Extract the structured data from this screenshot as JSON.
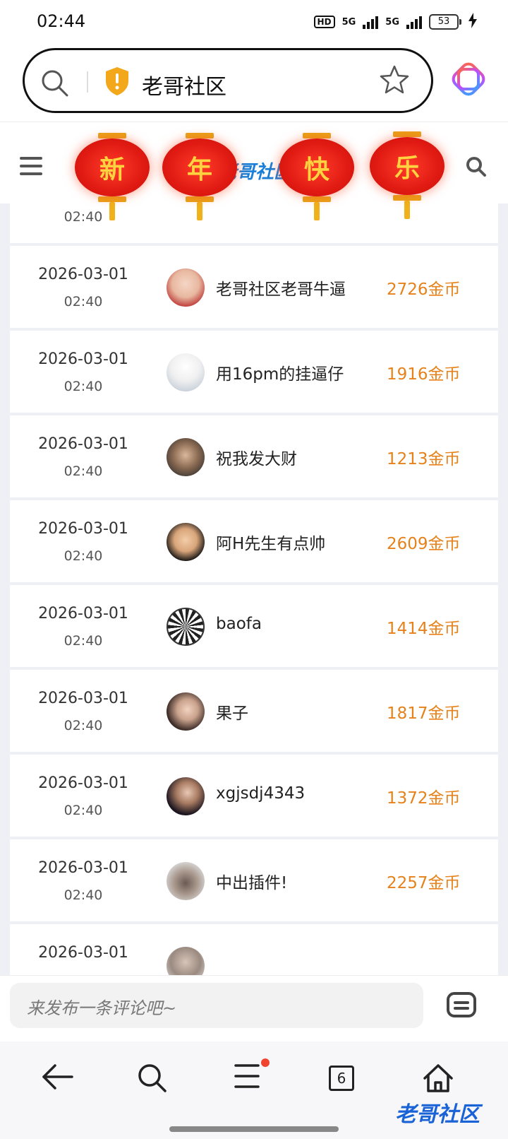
{
  "status": {
    "time": "02:44",
    "hd": "HD",
    "net1": "5G",
    "net2": "5G",
    "battery": "53"
  },
  "address": {
    "site": "老哥社区"
  },
  "site_header": {
    "logo": "老哥社区"
  },
  "lanterns": [
    "新",
    "年",
    "快",
    "乐"
  ],
  "rows": [
    {
      "date": "",
      "time": "02:40",
      "user": "",
      "coins": ""
    },
    {
      "date": "2026-03-01",
      "time": "02:40",
      "user": "老哥社区老哥牛逼",
      "coins": "2726金币"
    },
    {
      "date": "2026-03-01",
      "time": "02:40",
      "user": "用16pm的挂逼仔",
      "coins": "1916金币"
    },
    {
      "date": "2026-03-01",
      "time": "02:40",
      "user": "祝我发大财",
      "coins": "1213金币"
    },
    {
      "date": "2026-03-01",
      "time": "02:40",
      "user": "阿H先生有点帅",
      "coins": "2609金币"
    },
    {
      "date": "2026-03-01",
      "time": "02:40",
      "user": "baofa",
      "coins": "1414金币"
    },
    {
      "date": "2026-03-01",
      "time": "02:40",
      "user": "果子",
      "coins": "1817金币"
    },
    {
      "date": "2026-03-01",
      "time": "02:40",
      "user": "xgjsdj4343",
      "coins": "1372金币"
    },
    {
      "date": "2026-03-01",
      "time": "02:40",
      "user": "中出插件!",
      "coins": "2257金币"
    },
    {
      "date": "2026-03-01",
      "time": "",
      "user": "",
      "coins": ""
    }
  ],
  "comment": {
    "placeholder": "来发布一条评论吧~"
  },
  "nav": {
    "tab_count": "6"
  },
  "watermark": "老哥社区",
  "colors": {
    "accent_orange": "#e6821b",
    "lantern_red": "#e01a12",
    "lantern_gold": "#ffd23f"
  }
}
